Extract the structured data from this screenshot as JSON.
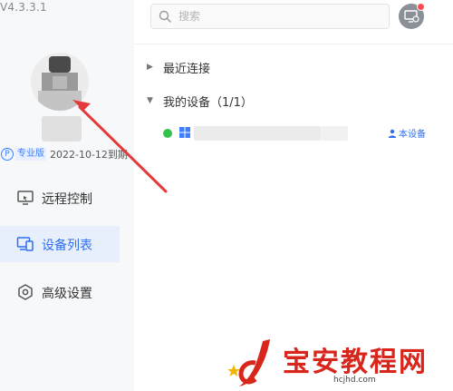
{
  "app": {
    "version": "V4.3.3.1"
  },
  "account": {
    "badge_letter": "P",
    "tier_label": "专业版",
    "expiry_text": "2022-10-12到期"
  },
  "sidebar": {
    "items": [
      {
        "label": "远程控制",
        "icon": "monitor-remote-icon",
        "active": false
      },
      {
        "label": "设备列表",
        "icon": "devices-icon",
        "active": true
      },
      {
        "label": "高级设置",
        "icon": "settings-hexagon-icon",
        "active": false
      }
    ]
  },
  "search": {
    "placeholder": "搜索",
    "value": ""
  },
  "groups": {
    "recent": {
      "label": "最近连接",
      "expanded": false
    },
    "mine": {
      "label": "我的设备（1/1）",
      "expanded": true
    }
  },
  "device": {
    "status": "online",
    "this_device_label": "本设备"
  },
  "watermark": {
    "title": "宝安教程网",
    "domain": "hcjhd.com"
  },
  "colors": {
    "accent": "#2d6ff0",
    "online": "#35c24a",
    "annotation": "#e43a3a",
    "watermark": "#d9261c"
  }
}
